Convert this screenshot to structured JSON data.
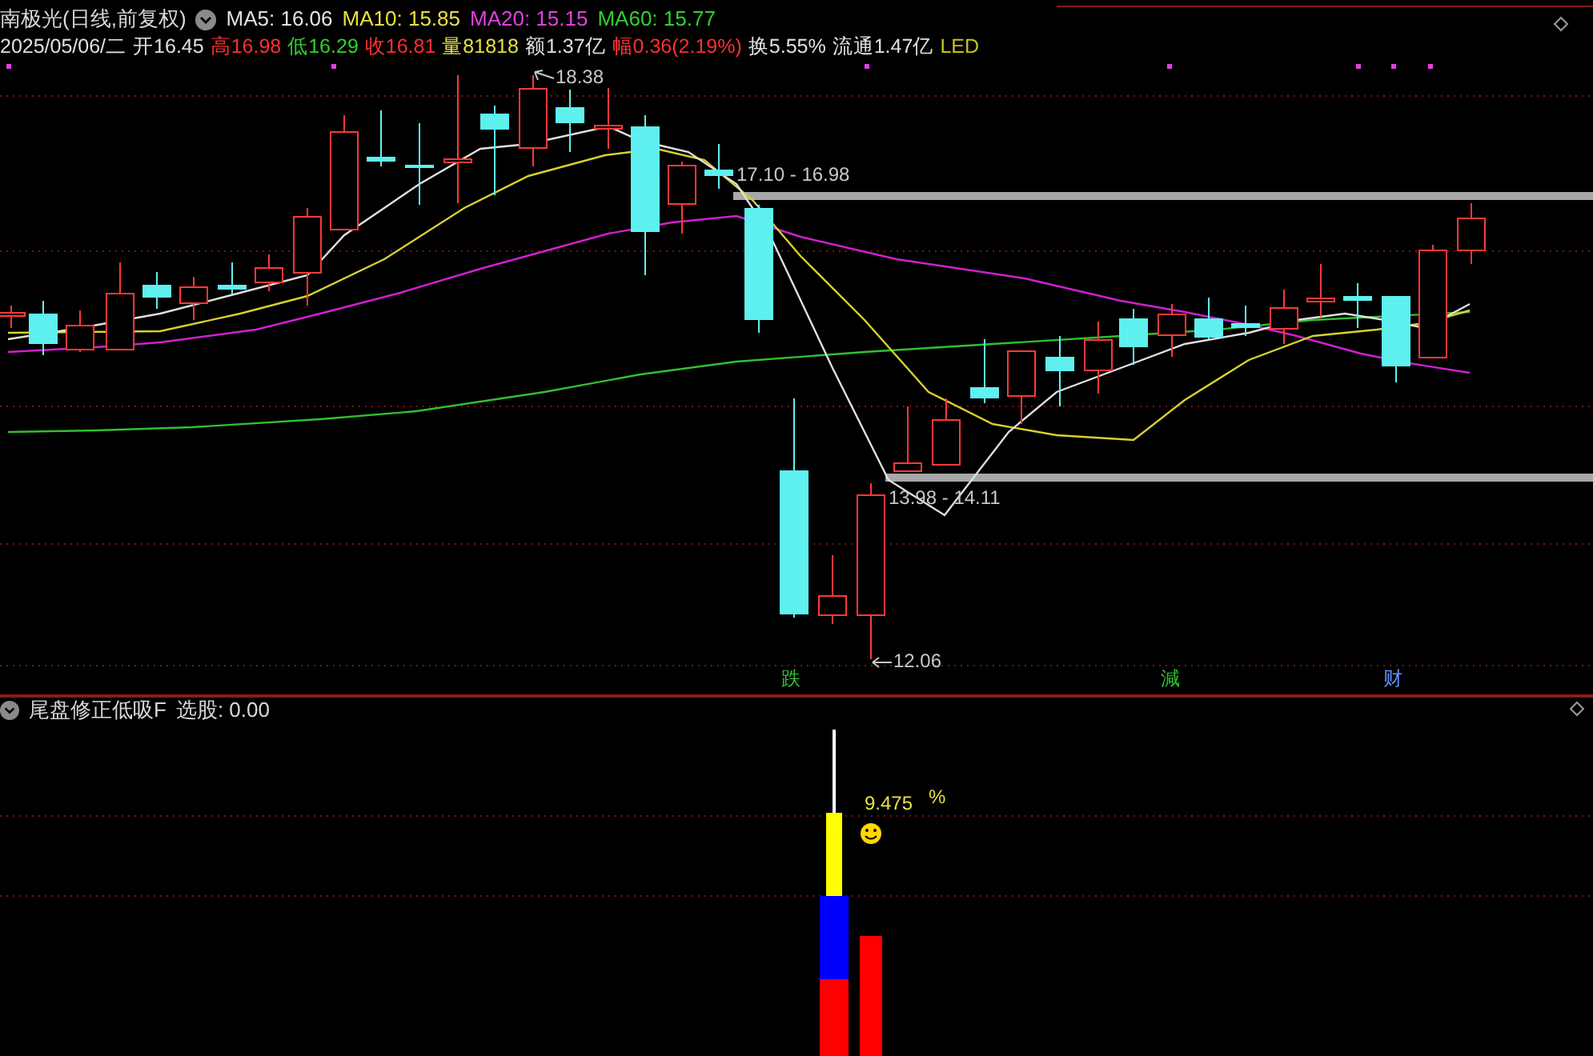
{
  "header": {
    "title": "南极光(日线,前复权)",
    "indicators": [
      {
        "text": "MA5: 16.06",
        "color": "#e0e0e0"
      },
      {
        "text": "MA10: 15.85",
        "color": "#e8e040"
      },
      {
        "text": "MA20: 15.15",
        "color": "#e040e0"
      },
      {
        "text": "MA60: 15.77",
        "color": "#30d030"
      }
    ]
  },
  "quote": [
    {
      "text": "2025/05/06/二",
      "color": "#e0e0e0"
    },
    {
      "text": "开16.45",
      "color": "#e0e0e0"
    },
    {
      "text": "高16.98",
      "color": "#ff3030"
    },
    {
      "text": "低16.29",
      "color": "#30d030"
    },
    {
      "text": "收16.81",
      "color": "#ff3030"
    },
    {
      "text": "量81818",
      "color": "#e8e040"
    },
    {
      "text": "额1.37亿",
      "color": "#e0e0e0"
    },
    {
      "text": "幅0.36(2.19%)",
      "color": "#ff3030"
    },
    {
      "text": "换5.55%",
      "color": "#e0e0e0"
    },
    {
      "text": "流通1.47亿",
      "color": "#e0e0e0"
    },
    {
      "text": "LED",
      "color": "#c8c020"
    }
  ],
  "price_labels": [
    {
      "text": "18.38"
    },
    {
      "text": "17.10 - 16.98"
    },
    {
      "text": "13.98 - 14.11"
    },
    {
      "text": "12.06"
    }
  ],
  "markers": [
    {
      "text": "跌",
      "color": "#30c030"
    },
    {
      "text": "減",
      "color": "#30c030"
    },
    {
      "text": "财",
      "color": "#6090ff"
    }
  ],
  "indicator_pane": {
    "title": "尾盘修正低吸F",
    "reading": "选股: 0.00",
    "value": "9.475",
    "unit": "%"
  }
}
